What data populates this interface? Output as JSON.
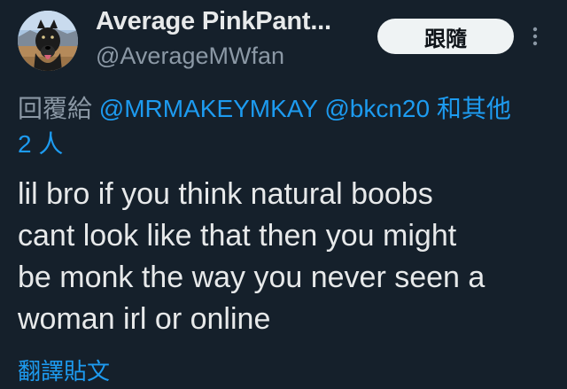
{
  "header": {
    "display_name": "Average PinkPant...",
    "handle": "@AverageMWfan",
    "follow_button_label": "跟隨",
    "more_icon": "more-vertical-icon",
    "avatar_icon": "dog-avatar-icon"
  },
  "reply_context": {
    "prefix": "回覆給",
    "mentions": [
      "@MRMAKEYMKAY",
      "@bkcn20"
    ],
    "others_label_line1": "和其他",
    "others_label_line2": "2 人"
  },
  "tweet": {
    "lines": [
      "lil bro if you think natural boobs",
      "cant look like that then you might",
      "be monk the way you never seen a",
      "woman irl or online"
    ]
  },
  "translate_label": "翻譯貼文",
  "colors": {
    "background": "#15202b",
    "text_primary": "#e7e9ea",
    "text_secondary": "#8b98a5",
    "accent": "#1d9bf0",
    "button_bg": "#eff3f4"
  }
}
